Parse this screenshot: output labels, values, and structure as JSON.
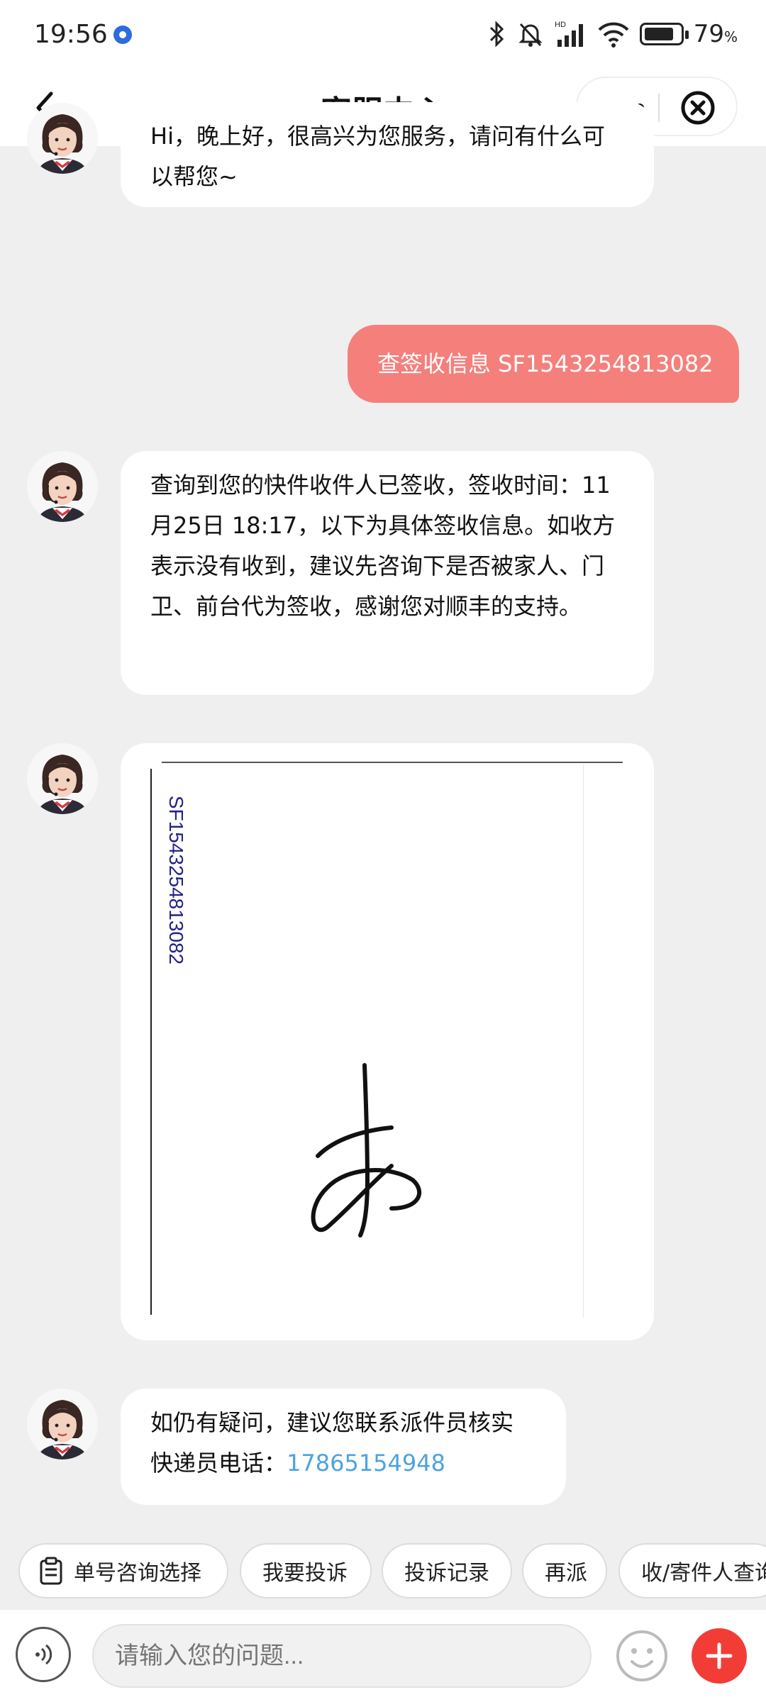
{
  "status_bar": {
    "time": "19:56",
    "battery_percent": "79",
    "battery_unit": "%",
    "network_label": "HD"
  },
  "nav": {
    "title": "客服中心"
  },
  "messages": {
    "greeting": "Hi，晚上好，很高兴为您服务，请问有什么可以帮您~",
    "user_query": "查签收信息 SF1543254813082",
    "sign_info": "查询到您的快件收件人已签收，签收时间：11月25日 18:17，以下为具体签收信息。如收方表示没有收到，建议先咨询下是否被家人、门卫、前台代为签收，感谢您对顺丰的支持。",
    "signature_waybill": "SF1543254813082",
    "contact_line1": "如仍有疑问，建议您联系派件员核实",
    "contact_line2_prefix": "快递员电话：",
    "courier_phone": "17865154948"
  },
  "quick_actions": [
    "单号咨询选择",
    "我要投诉",
    "投诉记录",
    "再派",
    "收/寄件人查询"
  ],
  "input": {
    "placeholder": "请输入您的问题..."
  },
  "colors": {
    "user_bubble": "#f57f7b",
    "link": "#4da3e0",
    "plus_button": "#f23d36"
  }
}
